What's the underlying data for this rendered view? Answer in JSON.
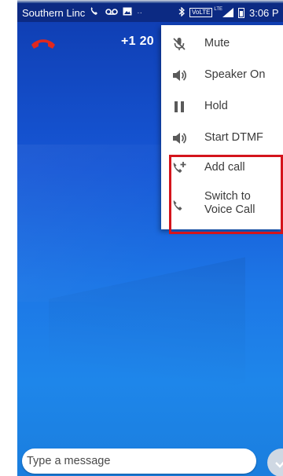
{
  "status_bar": {
    "carrier": "Southern Linc",
    "volte_label": "VoLTE",
    "network_type": "LTE",
    "time": "3:06 P"
  },
  "call": {
    "phone_number": "+1 20"
  },
  "menu": {
    "items": [
      {
        "label": "Mute",
        "icon": "mic-off-icon"
      },
      {
        "label": "Speaker On",
        "icon": "speaker-icon"
      },
      {
        "label": "Hold",
        "icon": "pause-icon"
      },
      {
        "label": "Start DTMF",
        "icon": "speaker-icon"
      },
      {
        "label": "Add call",
        "icon": "add-call-icon"
      },
      {
        "label": "Switch to Voice Call",
        "line1": "Switch to",
        "line2": "Voice Call",
        "icon": "phone-icon"
      }
    ]
  },
  "message_bar": {
    "placeholder": "Type a message"
  },
  "colors": {
    "status_bar": "#0c2a83",
    "background_top": "#0f3cb0",
    "background_bottom": "#1e86ea",
    "end_call": "#e0281e",
    "highlight": "#d4141c"
  }
}
